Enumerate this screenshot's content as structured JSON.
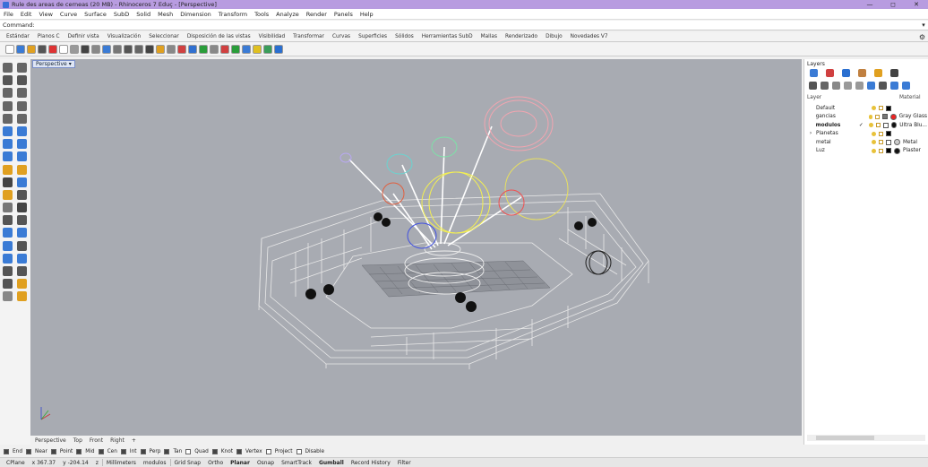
{
  "window": {
    "title": "Rule des areas de cerneas (20 MB) - Rhinoceros 7 Eduç - [Perspective]",
    "controls": [
      "—",
      "◻",
      "✕"
    ]
  },
  "menu": [
    "File",
    "Edit",
    "View",
    "Curve",
    "Surface",
    "SubD",
    "Solid",
    "Mesh",
    "Dimension",
    "Transform",
    "Tools",
    "Analyze",
    "Render",
    "Panels",
    "Help"
  ],
  "command": {
    "label": "Command:",
    "value": ""
  },
  "toolbar_tabs": [
    "Estándar",
    "Planos C",
    "Definir vista",
    "Visualización",
    "Seleccionar",
    "Disposición de las vistas",
    "Visibilidad",
    "Transformar",
    "Curvas",
    "Superficies",
    "Sólidos",
    "Herramientas SubD",
    "Mallas",
    "Renderizado",
    "Dibujo",
    "Novedades V7"
  ],
  "icon_colors": [
    "#ffffff",
    "#3a7bd5",
    "#e0a020",
    "#555555",
    "#dd3333",
    "#ffffff",
    "#999999",
    "#444444",
    "#888888",
    "#3a7bd5",
    "#777777",
    "#555555",
    "#666666",
    "#444444",
    "#e0a020",
    "#888888",
    "#d04040",
    "#3070d0",
    "#2a9d3a",
    "#888888",
    "#d04040",
    "#2a9d3a",
    "#3a7bd5",
    "#e0c020",
    "#3a9d5a",
    "#2a6fd0"
  ],
  "sidebar_colors": [
    "#666666",
    "#666666",
    "#555555",
    "#555555",
    "#666666",
    "#666666",
    "#666666",
    "#666666",
    "#666666",
    "#666666",
    "#3a7bd5",
    "#3a7bd5",
    "#3a7bd5",
    "#3a7bd5",
    "#3a7bd5",
    "#3a7bd5",
    "#e0a020",
    "#e0a020",
    "#444444",
    "#3a7bd5",
    "#e0a020",
    "#555555",
    "#777777",
    "#444444",
    "#555555",
    "#555555",
    "#3a7bd5",
    "#3a7bd5",
    "#3a7bd5",
    "#555555",
    "#3a7bd5",
    "#3a7bd5",
    "#555555",
    "#555555",
    "#555555",
    "#e0a020",
    "#888888",
    "#e0a020"
  ],
  "viewport": {
    "label": "Perspective",
    "menu_arrow": "▾"
  },
  "view_tabs": [
    "Perspective",
    "Top",
    "Front",
    "Right",
    "+"
  ],
  "panel": {
    "title": "Layers",
    "col_layer": "Layer",
    "col_material": "Material",
    "row1_colors": [
      "#3a7bd5",
      "#d04040",
      "#2a6fd0",
      "#c08040",
      "#e0a020",
      "#444444"
    ],
    "row2_colors": [
      "#555555",
      "#666666",
      "#888888",
      "#999999",
      "#999999",
      "#3a7bd5",
      "#555555",
      "#3a7bd5",
      "#3a7bd5"
    ],
    "layers": [
      {
        "expand": "",
        "name": "Default",
        "current": false,
        "check": "",
        "color": "#000000",
        "mat_color": "",
        "material": ""
      },
      {
        "expand": "",
        "name": "gancias",
        "current": false,
        "check": "",
        "color": "#777777",
        "mat_color": "#ee2222",
        "material": "Gray Glass"
      },
      {
        "expand": "",
        "name": "modulos",
        "current": true,
        "check": "✓",
        "color": "#ffffff",
        "mat_color": "#111111",
        "material": "Ultra Blu..."
      },
      {
        "expand": "›",
        "name": "Planetas",
        "current": false,
        "check": "",
        "color": "#000000",
        "mat_color": "",
        "material": ""
      },
      {
        "expand": "",
        "name": "metal",
        "current": false,
        "check": "",
        "color": "#ffffff",
        "mat_color": "#cccccc",
        "material": "Metal"
      },
      {
        "expand": "",
        "name": "Luz",
        "current": false,
        "check": "",
        "color": "#000000",
        "mat_color": "#111111",
        "material": "Plaster"
      }
    ]
  },
  "osnaps": [
    {
      "on": true,
      "label": "End"
    },
    {
      "on": true,
      "label": "Near"
    },
    {
      "on": true,
      "label": "Point"
    },
    {
      "on": true,
      "label": "Mid"
    },
    {
      "on": true,
      "label": "Cen"
    },
    {
      "on": true,
      "label": "Int"
    },
    {
      "on": true,
      "label": "Perp"
    },
    {
      "on": true,
      "label": "Tan"
    },
    {
      "on": false,
      "label": "Quad"
    },
    {
      "on": true,
      "label": "Knot"
    },
    {
      "on": true,
      "label": "Vertex"
    },
    {
      "on": false,
      "label": "Project"
    },
    {
      "on": false,
      "label": "Disable"
    }
  ],
  "status": {
    "plane": "CPlane",
    "x": "x 367.37",
    "y": "y -204.14",
    "z": "z",
    "units": "Millimeters",
    "layer": "modulos",
    "grid": "Grid Snap",
    "ortho": "Ortho",
    "planar": "Planar",
    "osnap": "Osnap",
    "smarttrack": "SmartTrack",
    "gumball": "Gumball",
    "history": "Record History",
    "filter": "Filter"
  }
}
